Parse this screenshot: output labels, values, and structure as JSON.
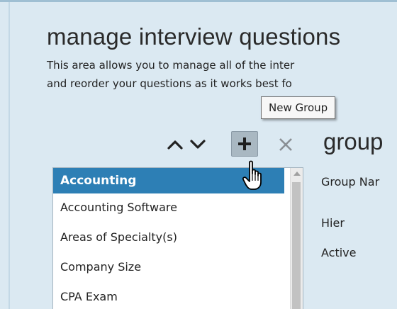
{
  "header": {
    "title": "manage interview questions",
    "description_line1": "This area allows you to manage all of the inter",
    "description_line2": "and reorder your questions as it works best fo"
  },
  "tooltip": {
    "text": "New Group"
  },
  "toolbar": {
    "move_up_icon": "chevron-up-icon",
    "move_down_icon": "chevron-down-icon",
    "add_icon": "plus-icon",
    "delete_icon": "x-icon"
  },
  "detail": {
    "heading": "group",
    "fields": {
      "group_name": "Group Nar",
      "hier": "Hier",
      "active": "Active"
    }
  },
  "group_list": {
    "selected_index": 0,
    "items": [
      {
        "label": "Accounting"
      },
      {
        "label": "Accounting Software"
      },
      {
        "label": "Areas of Specialty(s)"
      },
      {
        "label": "Company Size"
      },
      {
        "label": "CPA Exam"
      }
    ]
  },
  "colors": {
    "background": "#dbe9f2",
    "selected_row": "#2d7fb5",
    "add_button": "#a9b8c2"
  }
}
